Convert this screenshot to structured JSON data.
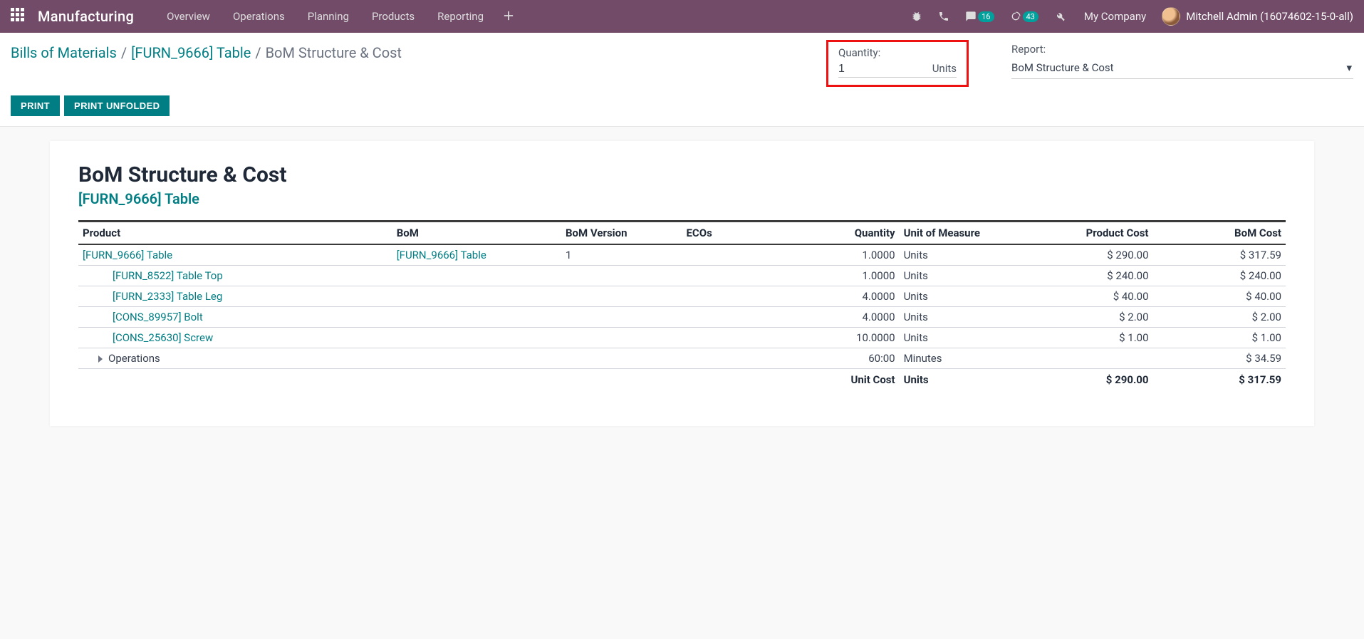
{
  "topbar": {
    "brand": "Manufacturing",
    "menu": [
      "Overview",
      "Operations",
      "Planning",
      "Products",
      "Reporting"
    ],
    "chat_badge": "16",
    "activity_badge": "43",
    "company": "My Company",
    "user": "Mitchell Admin (16074602-15-0-all)"
  },
  "breadcrumb": {
    "root": "Bills of Materials",
    "product": "[FURN_9666] Table",
    "current": "BoM Structure & Cost"
  },
  "controls": {
    "qty_label": "Quantity:",
    "qty_value": "1",
    "qty_unit": "Units",
    "report_label": "Report:",
    "report_value": "BoM Structure & Cost",
    "print": "PRINT",
    "print_unfolded": "PRINT UNFOLDED"
  },
  "report": {
    "title": "BoM Structure & Cost",
    "subtitle": "[FURN_9666] Table",
    "columns": {
      "product": "Product",
      "bom": "BoM",
      "bom_version": "BoM Version",
      "ecos": "ECOs",
      "quantity": "Quantity",
      "uom": "Unit of Measure",
      "product_cost": "Product Cost",
      "bom_cost": "BoM Cost"
    },
    "rows": [
      {
        "indent": 0,
        "product": "[FURN_9666] Table",
        "bom": "[FURN_9666] Table",
        "bom_version": "1",
        "ecos": "",
        "qty": "1.0000",
        "uom": "Units",
        "product_cost": "$ 290.00",
        "bom_cost": "$ 317.59"
      },
      {
        "indent": 1,
        "product": "[FURN_8522] Table Top",
        "bom": "",
        "bom_version": "",
        "ecos": "",
        "qty": "1.0000",
        "uom": "Units",
        "product_cost": "$ 240.00",
        "bom_cost": "$ 240.00"
      },
      {
        "indent": 1,
        "product": "[FURN_2333] Table Leg",
        "bom": "",
        "bom_version": "",
        "ecos": "",
        "qty": "4.0000",
        "uom": "Units",
        "product_cost": "$ 40.00",
        "bom_cost": "$ 40.00"
      },
      {
        "indent": 1,
        "product": "[CONS_89957] Bolt",
        "bom": "",
        "bom_version": "",
        "ecos": "",
        "qty": "4.0000",
        "uom": "Units",
        "product_cost": "$ 2.00",
        "bom_cost": "$ 2.00"
      },
      {
        "indent": 1,
        "product": "[CONS_25630] Screw",
        "bom": "",
        "bom_version": "",
        "ecos": "",
        "qty": "10.0000",
        "uom": "Units",
        "product_cost": "$ 1.00",
        "bom_cost": "$ 1.00"
      }
    ],
    "operations": {
      "label": "Operations",
      "qty": "60:00",
      "uom": "Minutes",
      "bom_cost": "$ 34.59"
    },
    "footer": {
      "label": "Unit Cost",
      "uom": "Units",
      "product_cost": "$ 290.00",
      "bom_cost": "$ 317.59"
    }
  }
}
